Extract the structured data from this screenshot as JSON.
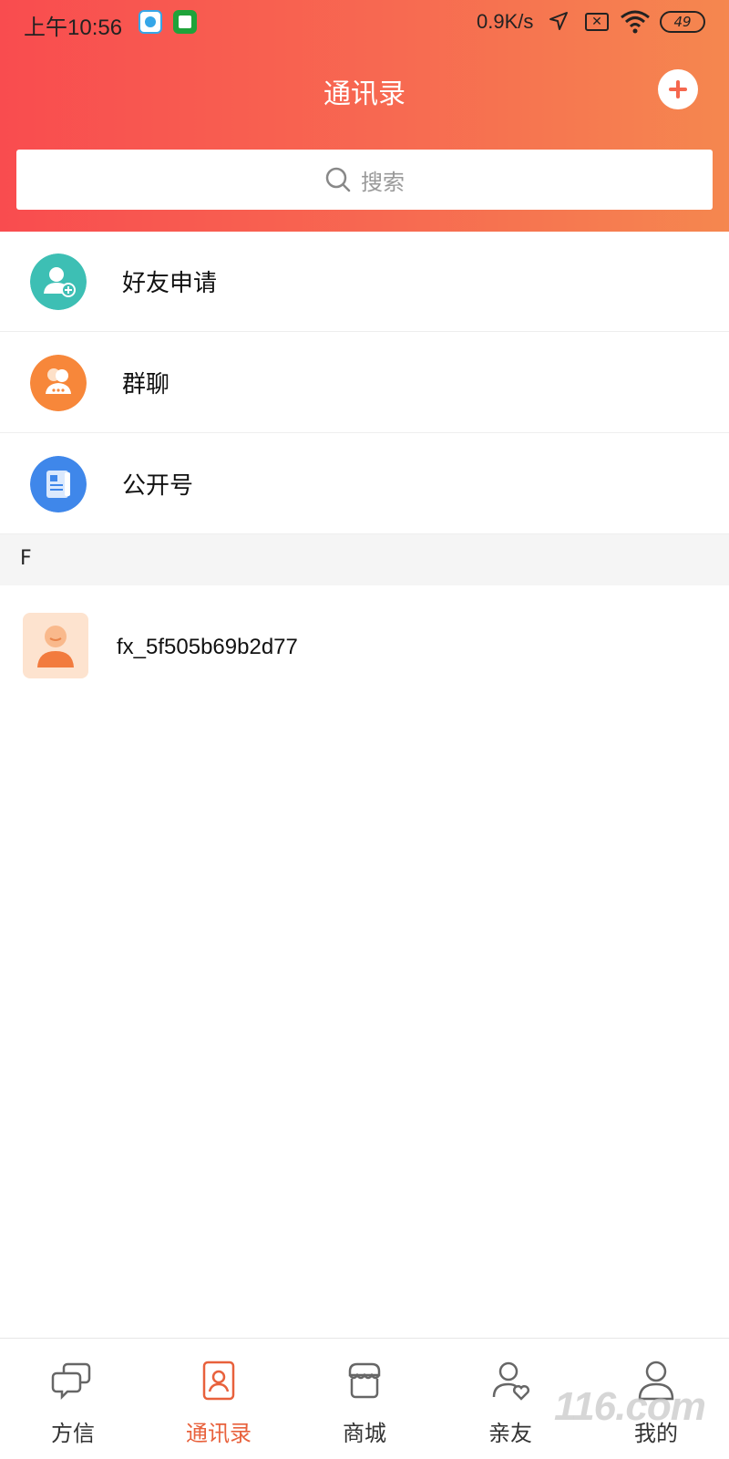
{
  "status_bar": {
    "time": "上午10:56",
    "speed": "0.9K/s",
    "battery": "49"
  },
  "header": {
    "title": "通讯录"
  },
  "search": {
    "placeholder": "搜索"
  },
  "menu": [
    {
      "label": "好友申请",
      "icon": "add-friend-icon",
      "color": "#3dbfb4"
    },
    {
      "label": "群聊",
      "icon": "group-chat-icon",
      "color": "#f7873a"
    },
    {
      "label": "公开号",
      "icon": "public-account-icon",
      "color": "#3f87ea"
    }
  ],
  "section": {
    "letter": "F"
  },
  "contacts": [
    {
      "name": "fx_5f505b69b2d77",
      "icon": "user-avatar-icon"
    }
  ],
  "tabbar": [
    {
      "label": "方信",
      "icon": "chat-icon",
      "active": false
    },
    {
      "label": "通讯录",
      "icon": "contacts-icon",
      "active": true
    },
    {
      "label": "商城",
      "icon": "store-icon",
      "active": false
    },
    {
      "label": "亲友",
      "icon": "family-icon",
      "active": false
    },
    {
      "label": "我的",
      "icon": "profile-icon",
      "active": false
    }
  ],
  "colors": {
    "accent": "#e8613c",
    "header_gradient_start": "#f94c4f",
    "header_gradient_end": "#f5874f"
  },
  "watermark": "116.com"
}
